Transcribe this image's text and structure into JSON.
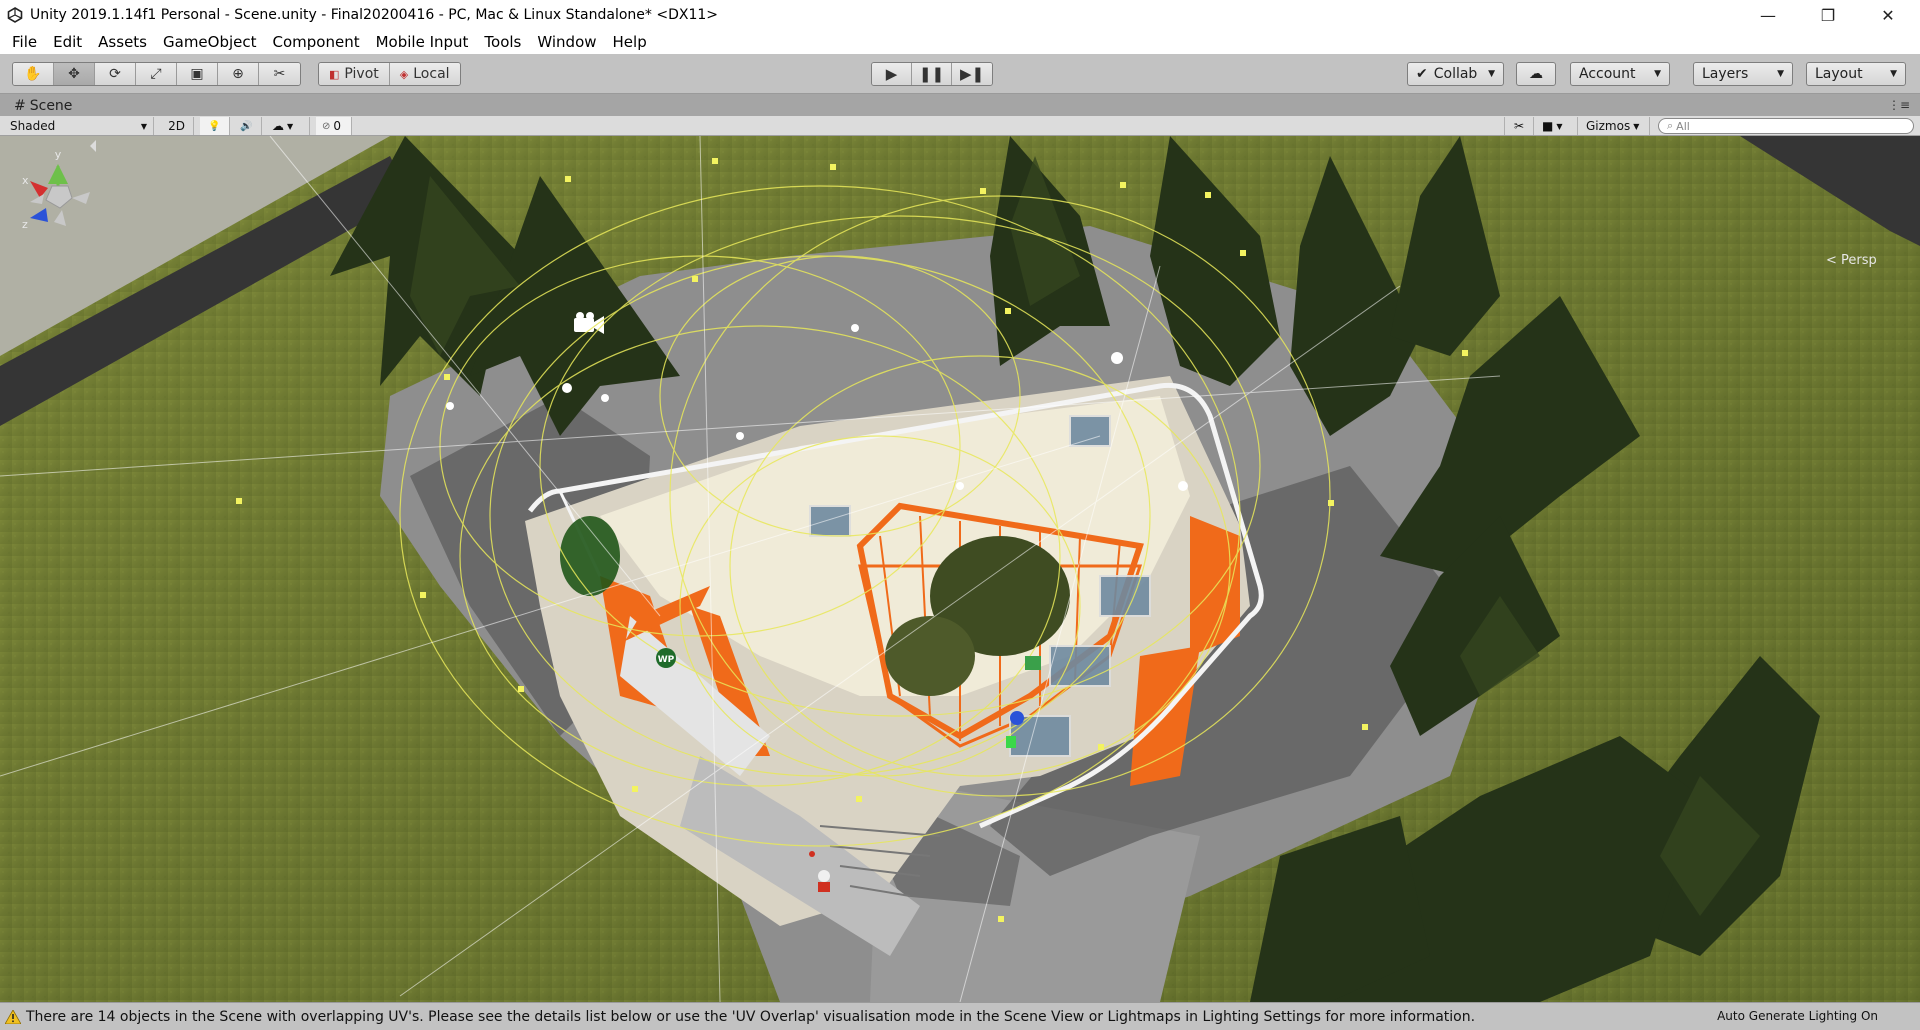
{
  "window": {
    "title": "Unity 2019.1.14f1 Personal - Scene.unity - Final20200416 - PC, Mac & Linux Standalone* <DX11>",
    "minimize": "—",
    "restore": "❐",
    "close": "✕"
  },
  "menu": [
    "File",
    "Edit",
    "Assets",
    "GameObject",
    "Component",
    "Mobile Input",
    "Tools",
    "Window",
    "Help"
  ],
  "toolbar": {
    "tools": [
      "hand-icon",
      "move-icon",
      "rotate-icon",
      "scale-icon",
      "rect-icon",
      "transform-icon",
      "custom-tool-icon"
    ],
    "tool_glyphs": [
      "✋",
      "✥",
      "⟳",
      "⤢",
      "▣",
      "⊕",
      "✂"
    ],
    "active_tool": "move-icon",
    "pivot_label": "Pivot",
    "local_label": "Local",
    "play_glyph": "▶",
    "pause_glyph": "❚❚",
    "step_glyph": "▶❚",
    "collab_label": "Collab",
    "cloud_glyph": "☁",
    "account_label": "Account",
    "layers_label": "Layers",
    "layout_label": "Layout"
  },
  "scene_tab": {
    "icon": "#",
    "label": "Scene",
    "menu_glyph": "⋮≡"
  },
  "scene_toolbar": {
    "shading_mode": "Shaded",
    "mode_2d": "2D",
    "lighting_glyph": "💡",
    "audio_glyph": "🔊",
    "effects_glyph": "☁",
    "hidden_count": "0",
    "gizmos_label": "Gizmos",
    "search_placeholder": "All"
  },
  "viewport": {
    "projection_label": "< Persp",
    "axis_labels": {
      "x": "x",
      "y": "y",
      "z": "z"
    },
    "waypoint_label": "WP"
  },
  "status": {
    "warning": "There are 14 objects in the Scene with overlapping UV's. Please see the details list below or use the 'UV Overlap' visualisation mode in the Scene View or Lightmaps in Lighting Settings for more information.",
    "lighting": "Auto Generate Lighting On"
  },
  "colors": {
    "grass": "#6f7a32",
    "road": "#3a3a3a",
    "pavement": "#8c8c8c",
    "building_orange": "#f06a1a",
    "gizmo_yellow": "#e8e85a",
    "tree": "#2c3a1f"
  }
}
